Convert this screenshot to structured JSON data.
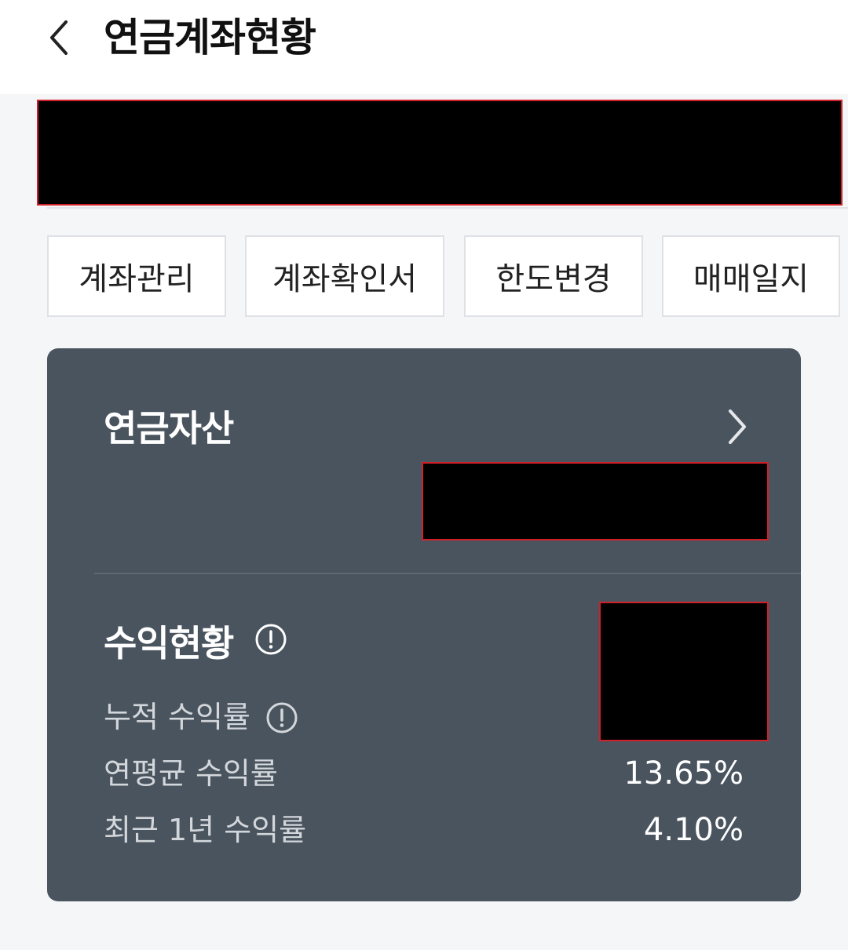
{
  "header": {
    "title": "연금계좌현황",
    "back_icon": "chevron-left-icon"
  },
  "actions": [
    {
      "label": "계좌관리"
    },
    {
      "label": "계좌확인서"
    },
    {
      "label": "한도변경"
    },
    {
      "label": "매매일지"
    }
  ],
  "card": {
    "asset_title": "연금자산",
    "profit_title": "수익현황",
    "rows": [
      {
        "label": "누적 수익률",
        "value": ""
      },
      {
        "label": "연평균 수익률",
        "value": "13.65%"
      },
      {
        "label": "최근 1년 수익률",
        "value": "4.10%"
      }
    ]
  },
  "colors": {
    "card_bg": "#4a545e",
    "redaction_border": "#d0202a"
  }
}
